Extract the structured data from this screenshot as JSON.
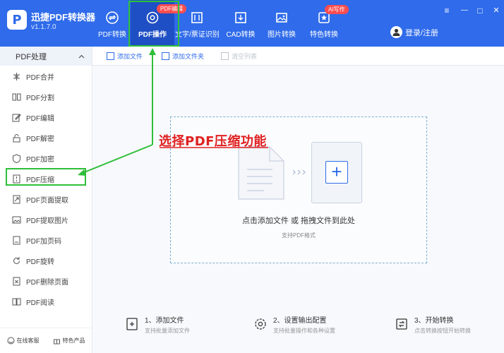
{
  "app": {
    "logo_char": "P",
    "title": "迅捷PDF转换器",
    "version": "v1.1.7.0"
  },
  "nav": [
    {
      "label": "PDF转换",
      "icon": "refresh-icon",
      "active": false
    },
    {
      "label": "PDF操作",
      "icon": "settings-icon",
      "active": true
    },
    {
      "label": "文字/票证识别",
      "icon": "scan-icon",
      "active": false
    },
    {
      "label": "CAD转换",
      "icon": "cad-download-icon",
      "active": false
    },
    {
      "label": "图片转换",
      "icon": "image-icon",
      "active": false
    },
    {
      "label": "特色转换",
      "icon": "star-icon",
      "active": false
    }
  ],
  "badges": {
    "pdf_edit": "PDF编辑",
    "ai": "AI写作"
  },
  "login": {
    "label": "登录/注册"
  },
  "window": {
    "menu": "≡",
    "minimize": "—",
    "maximize": "□",
    "close": "✕"
  },
  "sidebar": {
    "header": "PDF处理",
    "items": [
      {
        "label": "PDF合并",
        "icon": "merge-icon"
      },
      {
        "label": "PDF分割",
        "icon": "split-icon"
      },
      {
        "label": "PDF编辑",
        "icon": "edit-icon"
      },
      {
        "label": "PDF解密",
        "icon": "unlock-icon"
      },
      {
        "label": "PDF加密",
        "icon": "shield-icon"
      },
      {
        "label": "PDF压缩",
        "icon": "compress-icon",
        "selected": true
      },
      {
        "label": "PDF页面提取",
        "icon": "page-extract-icon"
      },
      {
        "label": "PDF提取图片",
        "icon": "image-extract-icon"
      },
      {
        "label": "PDF加页码",
        "icon": "page-number-icon"
      },
      {
        "label": "PDF旋转",
        "icon": "rotate-icon"
      },
      {
        "label": "PDF删除页面",
        "icon": "delete-page-icon"
      },
      {
        "label": "PDF阅读",
        "icon": "read-icon"
      }
    ],
    "bottom": {
      "service": "在线客服",
      "products": "特色产品"
    }
  },
  "toolbar": {
    "add_file": "添加文件",
    "add_folder": "添加文件夹",
    "clear_list": "清空列表"
  },
  "dropzone": {
    "text": "点击添加文件 或 拖拽文件到此处",
    "sub": "支持PDF格式"
  },
  "steps": [
    {
      "title": "1、添加文件",
      "desc": "支持批量添加文件"
    },
    {
      "title": "2、设置输出配置",
      "desc": "支持批量操作和各种设置"
    },
    {
      "title": "3、开始转换",
      "desc": "点击转换按钮开始转换"
    }
  ],
  "annotation": {
    "text": "选择PDF压缩功能"
  },
  "colors": {
    "brand": "#2f6bea",
    "highlight": "#2fbf3a",
    "annotation": "#e02020"
  }
}
